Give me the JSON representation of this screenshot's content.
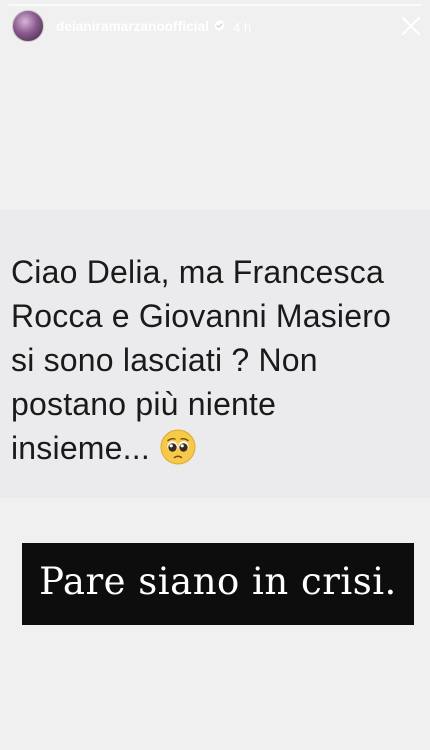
{
  "header": {
    "username": "deianiramarzanoofficial",
    "time": "4 h",
    "verified": true
  },
  "progress": {
    "fraction": 1.0
  },
  "icons": {
    "verified": "verified-badge-icon",
    "close": "close-icon",
    "emoji": "pleading-face-emoji"
  },
  "question": {
    "text": "Ciao Delia, ma Francesca\nRocca e Giovanni Masiero\nsi sono lasciati ? Non\npostano più niente\ninsieme..."
  },
  "caption": {
    "text": "Pare siano in crisi."
  },
  "colors": {
    "background": "#f0f0f1",
    "card": "#ebebed",
    "caption_bg": "#0d0d0d",
    "header_text": "#ffffff"
  }
}
